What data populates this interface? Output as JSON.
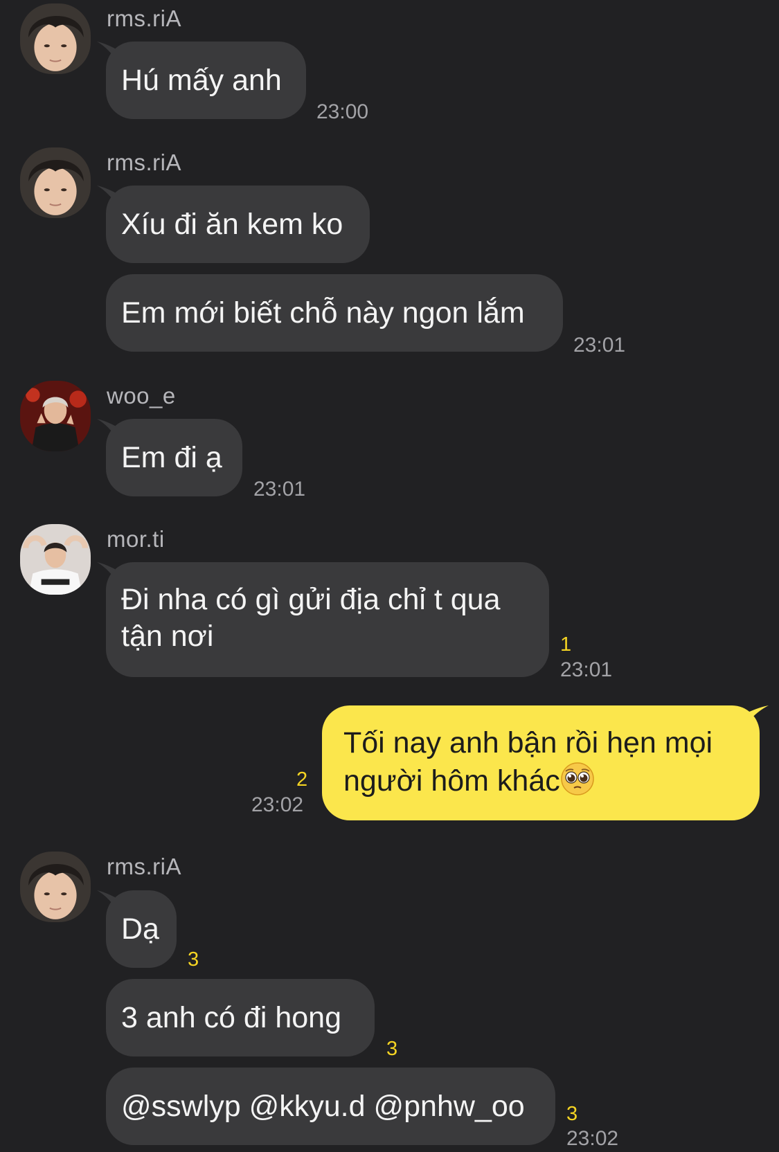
{
  "colors": {
    "background": "#212123",
    "incoming_bubble": "#3a3a3c",
    "outgoing_bubble": "#fbe64c",
    "unread_count": "#f5d423",
    "timestamp": "#a3a3a7",
    "sender_name": "#b6b6ba"
  },
  "messages": [
    {
      "sender": "rms.riA",
      "avatar": "avatar-photo",
      "bubbles": [
        "Hú mấy anh"
      ],
      "time": "23:00"
    },
    {
      "sender": "rms.riA",
      "avatar": "avatar-photo",
      "bubbles": [
        "Xíu đi ăn kem ko",
        "Em mới biết chỗ này ngon lắm"
      ],
      "time": "23:01"
    },
    {
      "sender": "woo_e",
      "avatar": "avatar-photo",
      "bubbles": [
        "Em đi ạ"
      ],
      "time": "23:01"
    },
    {
      "sender": "mor.ti",
      "avatar": "avatar-photo",
      "bubbles": [
        "Đi nha có gì gửi địa chỉ t qua tận nơi"
      ],
      "unread": "1",
      "time": "23:01"
    },
    {
      "sender": "me",
      "outgoing": true,
      "bubbles": [
        "Tối nay anh bận rồi hẹn mọi người hôm khác"
      ],
      "emoji": "pleading-face-emoji",
      "unread": "2",
      "time": "23:02"
    },
    {
      "sender": "rms.riA",
      "avatar": "avatar-photo",
      "bubbles": [
        "Dạ",
        "3 anh có đi hong",
        "@sswlyp @kkyu.d @pnhw_oo"
      ],
      "unread": [
        "3",
        "3",
        "3"
      ],
      "time": "23:02"
    }
  ]
}
